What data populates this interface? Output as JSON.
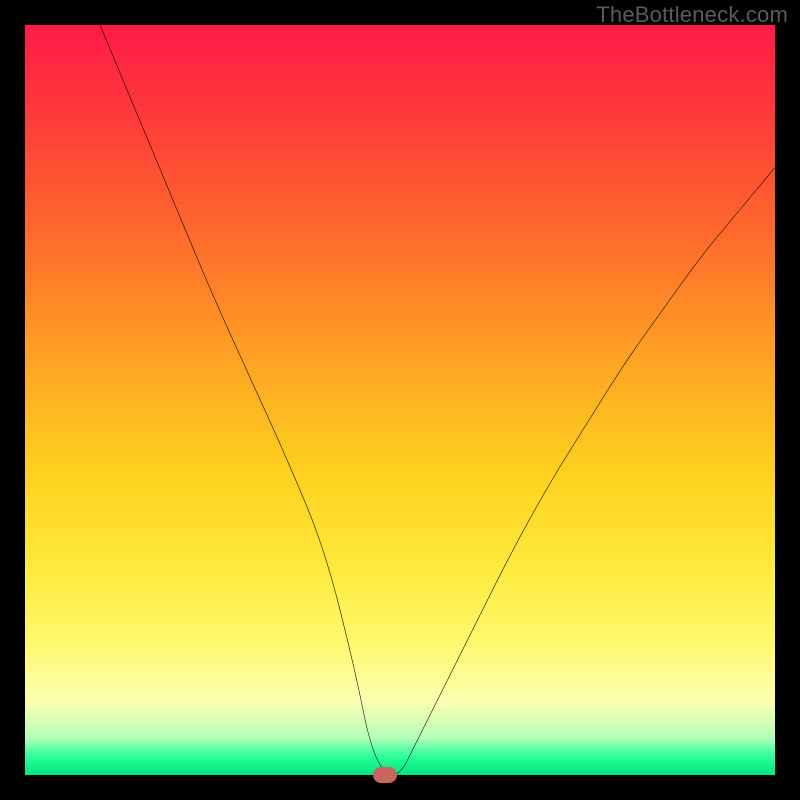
{
  "watermark": "TheBottleneck.com",
  "chart_data": {
    "type": "line",
    "title": "",
    "xlabel": "",
    "ylabel": "",
    "xlim": [
      0,
      100
    ],
    "ylim": [
      0,
      100
    ],
    "grid": false,
    "legend": false,
    "background": "heatmap-gradient",
    "marker": {
      "x": 48,
      "y": 0,
      "color": "#c9655f"
    },
    "series": [
      {
        "name": "bottleneck-curve",
        "color": "#000000",
        "x": [
          10,
          15,
          20,
          25,
          30,
          35,
          40,
          44,
          46,
          48,
          50,
          52,
          55,
          60,
          65,
          70,
          75,
          80,
          85,
          90,
          95,
          100
        ],
        "y": [
          100,
          88,
          76,
          64,
          53,
          42,
          30,
          14,
          4,
          0,
          0,
          4,
          10,
          20,
          30,
          39,
          47,
          55,
          62,
          69,
          75,
          81
        ]
      }
    ]
  }
}
